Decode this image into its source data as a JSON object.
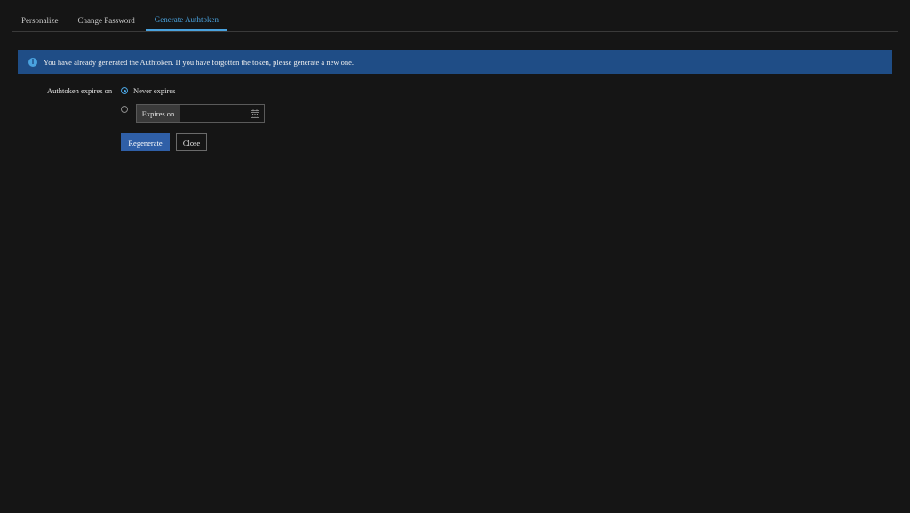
{
  "tabs": [
    {
      "label": "Personalize",
      "active": false
    },
    {
      "label": "Change Password",
      "active": false
    },
    {
      "label": "Generate Authtoken",
      "active": true
    }
  ],
  "banner": {
    "icon": "info-icon",
    "text": "You have already generated the Authtoken. If you have forgotten the token, please generate a new one."
  },
  "form": {
    "expires_label": "Authtoken expires on",
    "options": {
      "never": {
        "label": "Never expires",
        "selected": true
      },
      "expires_on": {
        "label": "Expires on",
        "selected": false,
        "value": "",
        "placeholder": ""
      }
    }
  },
  "actions": {
    "regenerate_label": "Regenerate",
    "close_label": "Close"
  },
  "colors": {
    "background": "#151515",
    "accent": "#4aa3df",
    "banner": "#1f4d86",
    "primary_button": "#2f5fa7"
  }
}
